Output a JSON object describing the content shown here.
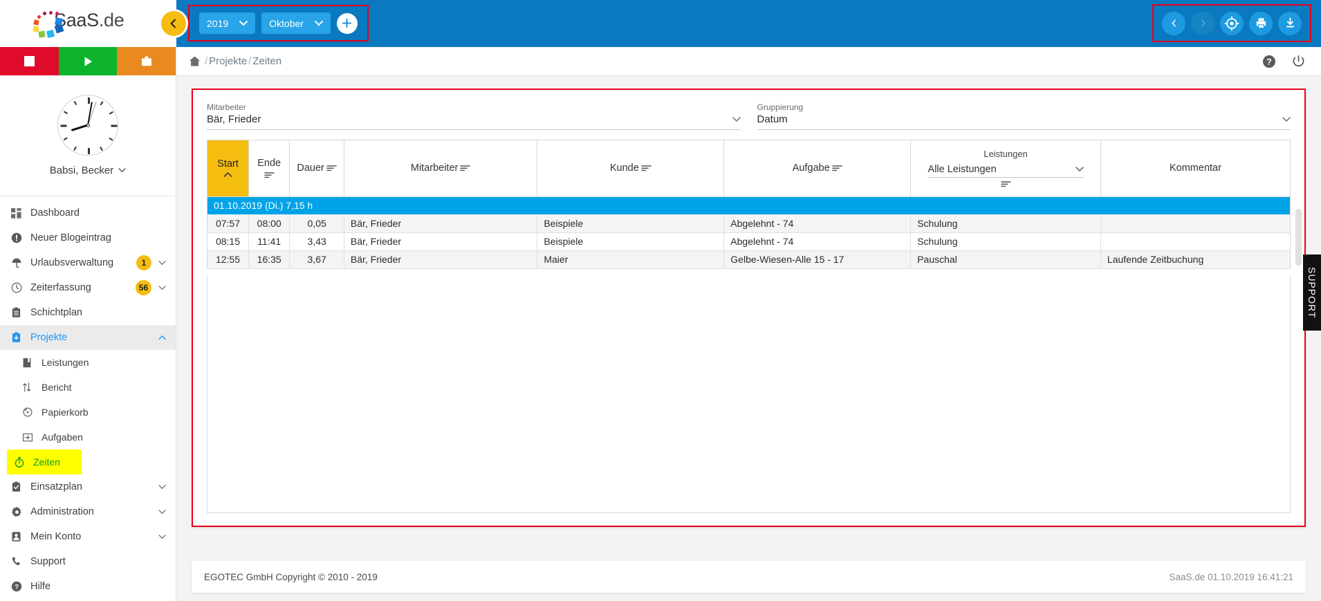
{
  "app": {
    "logo_text": "SaaS",
    "logo_suffix": ".de"
  },
  "topbar": {
    "collapse_icon": "chevron-left-icon",
    "year": "2019",
    "month": "Oktober",
    "add_label": "+",
    "actions": [
      {
        "name": "prev-icon",
        "glyph": "‹",
        "disabled": false
      },
      {
        "name": "next-icon",
        "glyph": "›",
        "disabled": true
      },
      {
        "name": "locate-icon",
        "glyph": "target",
        "disabled": false
      },
      {
        "name": "print-icon",
        "glyph": "printer",
        "disabled": false
      },
      {
        "name": "download-icon",
        "glyph": "download",
        "disabled": false
      }
    ]
  },
  "quickbar": [
    {
      "name": "stop-button",
      "icon": "stop-icon",
      "color": "#e00b2b"
    },
    {
      "name": "play-button",
      "icon": "play-icon",
      "color": "#0db32b"
    },
    {
      "name": "briefcase-button",
      "icon": "briefcase-icon",
      "color": "#e98a20"
    }
  ],
  "profile": {
    "name": "Babsi, Becker",
    "caret": "⌄"
  },
  "sidebar": {
    "items": [
      {
        "label": "Dashboard",
        "icon": "grid-icon",
        "level": 0,
        "badge": null,
        "chevron": null,
        "active": false,
        "highlight": false
      },
      {
        "label": "Neuer Blogeintrag",
        "icon": "alert-icon",
        "level": 0,
        "badge": null,
        "chevron": null,
        "active": false,
        "highlight": false
      },
      {
        "label": "Urlaubsverwaltung",
        "icon": "umbrella-icon",
        "level": 0,
        "badge": "1",
        "chevron": "down",
        "active": false,
        "highlight": false
      },
      {
        "label": "Zeiterfassung",
        "icon": "clock-icon",
        "level": 0,
        "badge": "56",
        "chevron": "down",
        "active": false,
        "highlight": false
      },
      {
        "label": "Schichtplan",
        "icon": "clipboard-icon",
        "level": 0,
        "badge": null,
        "chevron": null,
        "active": false,
        "highlight": false
      },
      {
        "label": "Projekte",
        "icon": "projects-icon",
        "level": 0,
        "badge": null,
        "chevron": "up",
        "active": true,
        "highlight": false
      },
      {
        "label": "Leistungen",
        "icon": "book-icon",
        "level": 1,
        "badge": null,
        "chevron": null,
        "active": false,
        "highlight": false
      },
      {
        "label": "Bericht",
        "icon": "sort-arrows-icon",
        "level": 1,
        "badge": null,
        "chevron": null,
        "active": false,
        "highlight": false
      },
      {
        "label": "Papierkorb",
        "icon": "restore-icon",
        "level": 1,
        "badge": null,
        "chevron": null,
        "active": false,
        "highlight": false
      },
      {
        "label": "Aufgaben",
        "icon": "tasks-icon",
        "level": 1,
        "badge": null,
        "chevron": null,
        "active": false,
        "highlight": false
      },
      {
        "label": "Zeiten",
        "icon": "stopwatch-icon",
        "level": 1,
        "badge": null,
        "chevron": null,
        "active": false,
        "highlight": true
      },
      {
        "label": "Einsatzplan",
        "icon": "checklist-icon",
        "level": 0,
        "badge": null,
        "chevron": "down",
        "active": false,
        "highlight": false
      },
      {
        "label": "Administration",
        "icon": "gear-icon",
        "level": 0,
        "badge": null,
        "chevron": "down",
        "active": false,
        "highlight": false
      },
      {
        "label": "Mein Konto",
        "icon": "user-icon",
        "level": 0,
        "badge": null,
        "chevron": "down",
        "active": false,
        "highlight": false
      },
      {
        "label": "Support",
        "icon": "phone-icon",
        "level": 0,
        "badge": null,
        "chevron": null,
        "active": false,
        "highlight": false
      },
      {
        "label": "Hilfe",
        "icon": "question-icon",
        "level": 0,
        "badge": null,
        "chevron": null,
        "active": false,
        "highlight": false
      }
    ]
  },
  "breadcrumb": {
    "home_icon": "home-icon",
    "parts": [
      "Projekte",
      "Zeiten"
    ],
    "raw": "/Projekte/Zeiten",
    "help_icon": "help-icon",
    "power_icon": "power-icon"
  },
  "filters": {
    "employee": {
      "label": "Mitarbeiter",
      "value": "Bär, Frieder"
    },
    "grouping": {
      "label": "Gruppierung",
      "value": "Datum"
    }
  },
  "table": {
    "columns": [
      {
        "key": "start",
        "label": "Start",
        "sorted": true,
        "sort_dir": "asc",
        "filter": false
      },
      {
        "key": "ende",
        "label": "Ende",
        "sorted": false,
        "sort_dir": null,
        "filter": true
      },
      {
        "key": "dauer",
        "label": "Dauer",
        "sorted": false,
        "sort_dir": null,
        "filter": true
      },
      {
        "key": "mitarbeiter",
        "label": "Mitarbeiter",
        "sorted": false,
        "sort_dir": null,
        "filter": true
      },
      {
        "key": "kunde",
        "label": "Kunde",
        "sorted": false,
        "sort_dir": null,
        "filter": true
      },
      {
        "key": "aufgabe",
        "label": "Aufgabe",
        "sorted": false,
        "sort_dir": null,
        "filter": true
      },
      {
        "key": "leistungen",
        "label": "Leistungen",
        "sorted": false,
        "sort_dir": null,
        "filter": true,
        "select_value": "Alle Leistungen"
      },
      {
        "key": "kommentar",
        "label": "Kommentar",
        "sorted": false,
        "sort_dir": null,
        "filter": false
      }
    ],
    "group_row": "01.10.2019 (Di.) 7,15 h",
    "rows": [
      {
        "start": "07:57",
        "ende": "08:00",
        "dauer": "0,05",
        "mitarbeiter": "Bär, Frieder",
        "kunde": "Beispiele",
        "aufgabe": "Abgelehnt - 74",
        "leistungen": "Schulung",
        "kommentar": ""
      },
      {
        "start": "08:15",
        "ende": "11:41",
        "dauer": "3,43",
        "mitarbeiter": "Bär, Frieder",
        "kunde": "Beispiele",
        "aufgabe": "Abgelehnt - 74",
        "leistungen": "Schulung",
        "kommentar": ""
      },
      {
        "start": "12:55",
        "ende": "16:35",
        "dauer": "3,67",
        "mitarbeiter": "Bär, Frieder",
        "kunde": "Maier",
        "aufgabe": "Gelbe-Wiesen-Alle 15 - 17",
        "leistungen": "Pauschal",
        "kommentar": "Laufende Zeitbuchung"
      }
    ]
  },
  "footer": {
    "left": "EGOTEC GmbH Copyright © 2010 - 2019",
    "right": "SaaS.de  01.10.2019 16:41:21"
  },
  "support_tab": {
    "label": "SUPPORT"
  },
  "colors": {
    "brand_blue": "#0b79bf",
    "accent_blue": "#28a4e8",
    "group_row": "#00a3e8",
    "sort_yellow": "#f5bd10",
    "highlight_yellow": "#ffff00",
    "highlight_text_green": "#0a9d28",
    "annotation_red": "#e8001b"
  }
}
